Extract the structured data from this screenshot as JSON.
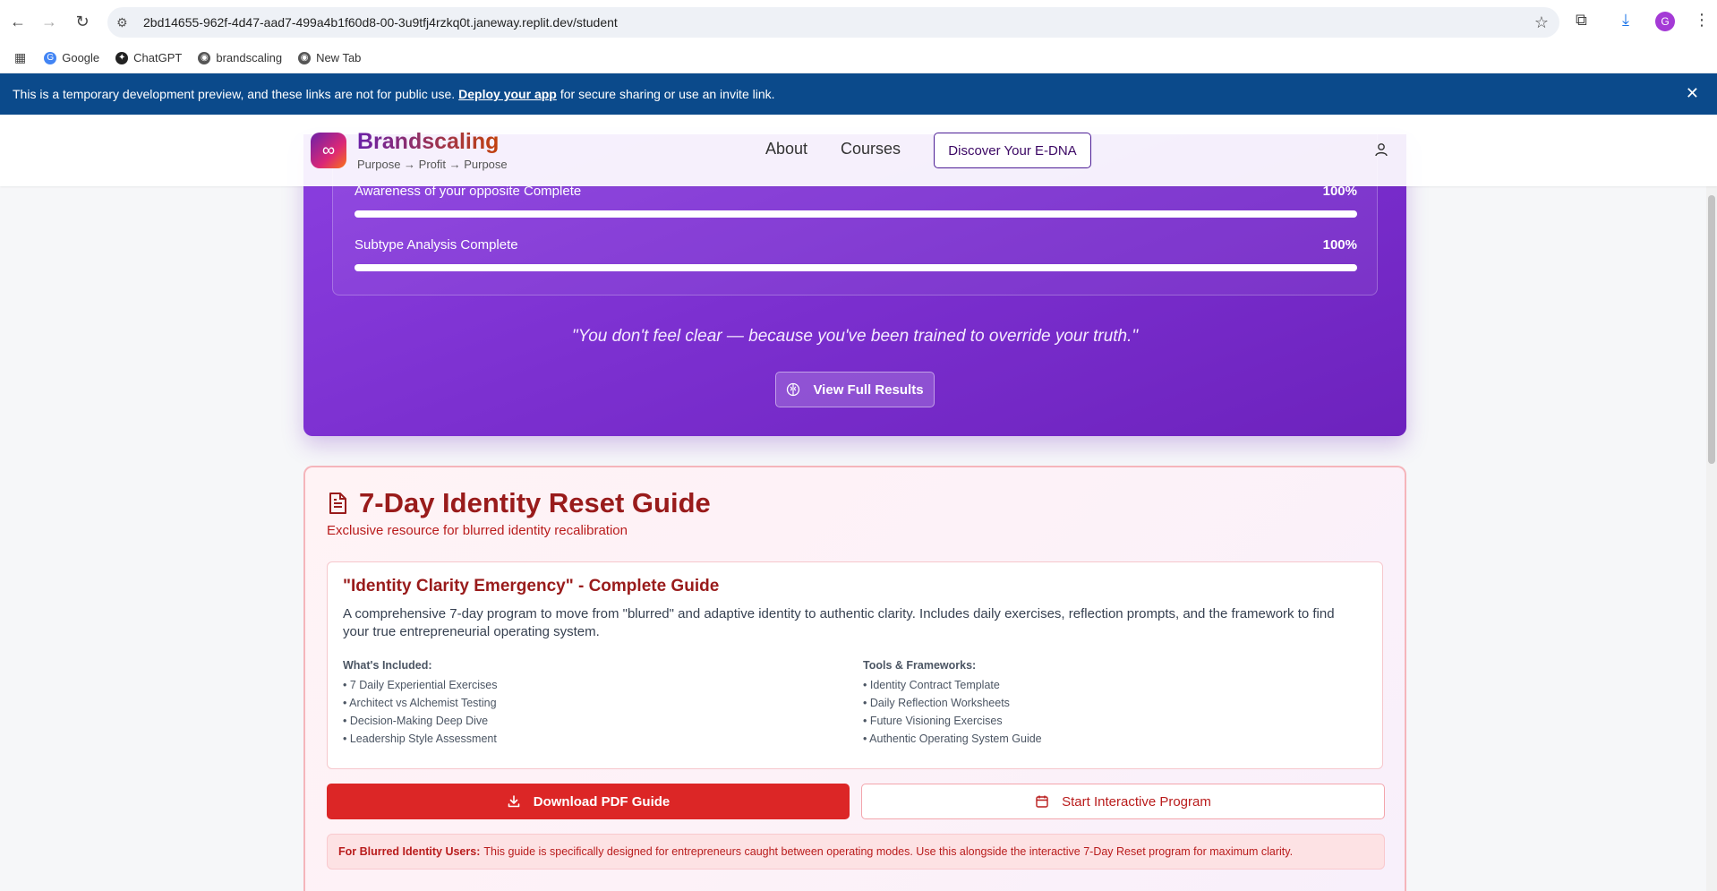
{
  "browser": {
    "url": "2bd14655-962f-4d47-aad7-499a4b1f60d8-00-3u9tfj4rzkq0t.janeway.replit.dev/student",
    "avatar_letter": "G",
    "bookmarks": [
      "Google",
      "ChatGPT",
      "brandscaling",
      "New Tab"
    ]
  },
  "dev_banner": {
    "text_before": "This is a temporary development preview, and these links are not for public use.",
    "link": "Deploy your app",
    "text_after": "for secure sharing or use an invite link."
  },
  "header": {
    "brand": "Brandscaling",
    "tagline": "Purpose → Profit → Purpose",
    "nav": [
      "About",
      "Courses"
    ],
    "cta": "Discover Your E-DNA"
  },
  "results": {
    "progress": [
      {
        "label": "Awareness of your opposite Complete",
        "percent_label": "100%",
        "value": 1.0
      },
      {
        "label": "Subtype Analysis Complete",
        "percent_label": "100%",
        "value": 1.0
      }
    ],
    "quote": "\"You don't feel clear — because you've been trained to override your truth.\"",
    "view_button": "View Full Results"
  },
  "guide": {
    "title": "7-Day Identity Reset Guide",
    "subtitle": "Exclusive resource for blurred identity recalibration",
    "box_title": "\"Identity Clarity Emergency\" - Complete Guide",
    "box_desc": "A comprehensive 7-day program to move from \"blurred\" and adaptive identity to authentic clarity. Includes daily exercises, reflection prompts, and the framework to find your true entrepreneurial operating system.",
    "included_heading": "What's Included:",
    "included": [
      "• 7 Daily Experiential Exercises",
      "• Architect vs Alchemist Testing",
      "• Decision-Making Deep Dive",
      "• Leadership Style Assessment"
    ],
    "tools_heading": "Tools & Frameworks:",
    "tools": [
      "• Identity Contract Template",
      "• Daily Reflection Worksheets",
      "• Future Visioning Exercises",
      "• Authentic Operating System Guide"
    ],
    "download_button": "Download PDF Guide",
    "start_button": "Start Interactive Program",
    "notice_label": "For Blurred Identity Users:",
    "notice_text": "This guide is specifically designed for entrepreneurs caught between operating modes. Use this alongside the interactive 7-Day Reset program for maximum clarity."
  },
  "colors": {
    "banner": "#0b4a8b",
    "purple": "#7b2fcf",
    "red": "#dc2626",
    "dark_red": "#991b1b"
  }
}
